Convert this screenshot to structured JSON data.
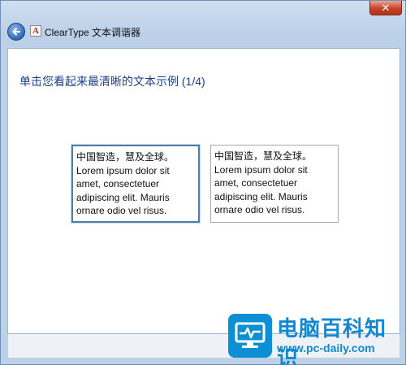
{
  "window": {
    "title": "ClearType 文本调谐器",
    "close_label": "✕",
    "app_icon_letter": "A"
  },
  "main": {
    "heading": "单击您看起来最清晰的文本示例 (1/4)",
    "samples": [
      {
        "line1": "中国智造，慧及全球。",
        "line2": "Lorem ipsum dolor sit amet, consectetuer adipiscing elit. Mauris ornare odio vel risus."
      },
      {
        "line1": "中国智造，慧及全球。",
        "line2": "Lorem ipsum dolor sit amet, consectetuer adipiscing elit. Mauris ornare odio vel risus."
      }
    ]
  },
  "watermark": {
    "title": "电脑百科知识",
    "url": "www.pc-daily.com",
    "icon": "monitor-icon"
  },
  "colors": {
    "heading": "#1a3f8a",
    "selected_border": "#4f7ea8",
    "watermark": "#1288d2"
  }
}
